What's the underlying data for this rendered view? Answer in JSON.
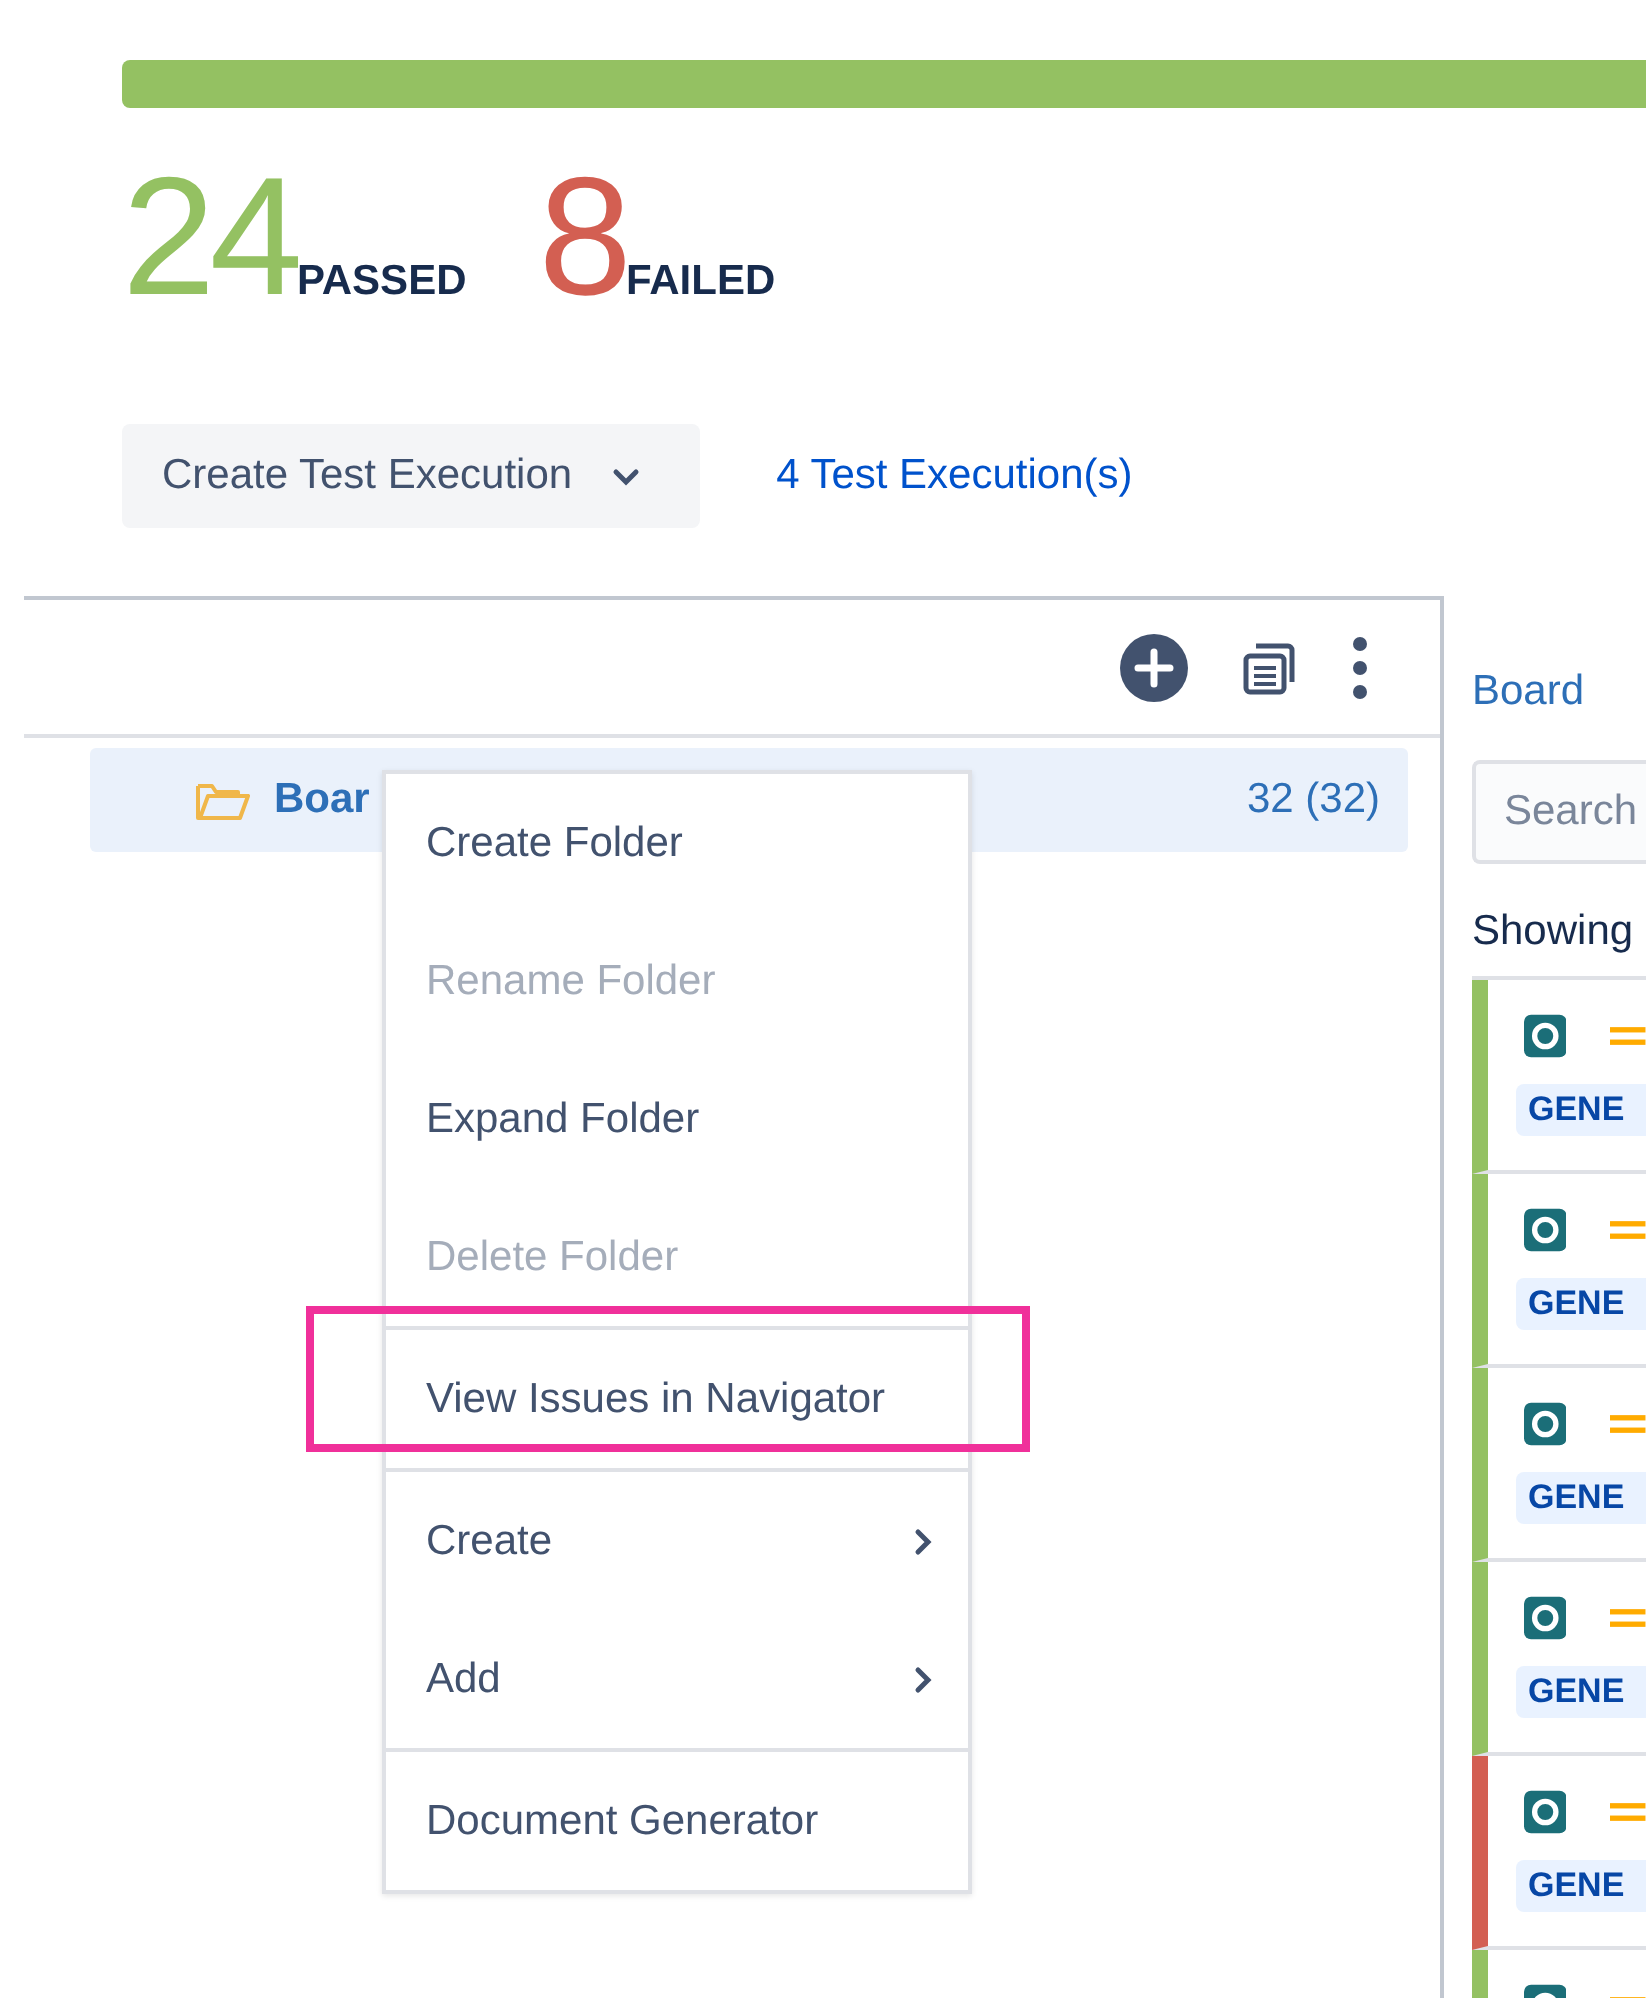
{
  "summary": {
    "passed": {
      "count": "24",
      "label": "PASSED"
    },
    "failed": {
      "count": "8",
      "label": "FAILED"
    }
  },
  "actions": {
    "create_button": "Create Test Execution",
    "executions_link": "4 Test Execution(s)"
  },
  "tree": {
    "folder": {
      "name": "Boar",
      "count": "32 (32)",
      "selected": true
    }
  },
  "context_menu": {
    "groups": [
      [
        {
          "label": "Create Folder",
          "disabled": false,
          "submenu": false,
          "highlighted": false
        },
        {
          "label": "Rename Folder",
          "disabled": true,
          "submenu": false,
          "highlighted": false
        },
        {
          "label": "Expand Folder",
          "disabled": false,
          "submenu": false,
          "highlighted": false
        },
        {
          "label": "Delete Folder",
          "disabled": true,
          "submenu": false,
          "highlighted": false
        }
      ],
      [
        {
          "label": "View Issues in Navigator",
          "disabled": false,
          "submenu": false,
          "highlighted": true
        }
      ],
      [
        {
          "label": "Create",
          "disabled": false,
          "submenu": true,
          "highlighted": false
        },
        {
          "label": "Add",
          "disabled": false,
          "submenu": true,
          "highlighted": false
        }
      ],
      [
        {
          "label": "Document Generator",
          "disabled": false,
          "submenu": false,
          "highlighted": false
        }
      ]
    ]
  },
  "right_panel": {
    "breadcrumb": "Board",
    "search": {
      "placeholder": "Search"
    },
    "showing": "Showing",
    "cards": [
      {
        "tag": "GENE",
        "color": "#94c162"
      },
      {
        "tag": "GENE",
        "color": "#94c162"
      },
      {
        "tag": "GENE",
        "color": "#94c162"
      },
      {
        "tag": "GENE",
        "color": "#94c162"
      },
      {
        "tag": "GENE",
        "color": "#d35f52"
      },
      {
        "color": "#94c162"
      }
    ]
  }
}
